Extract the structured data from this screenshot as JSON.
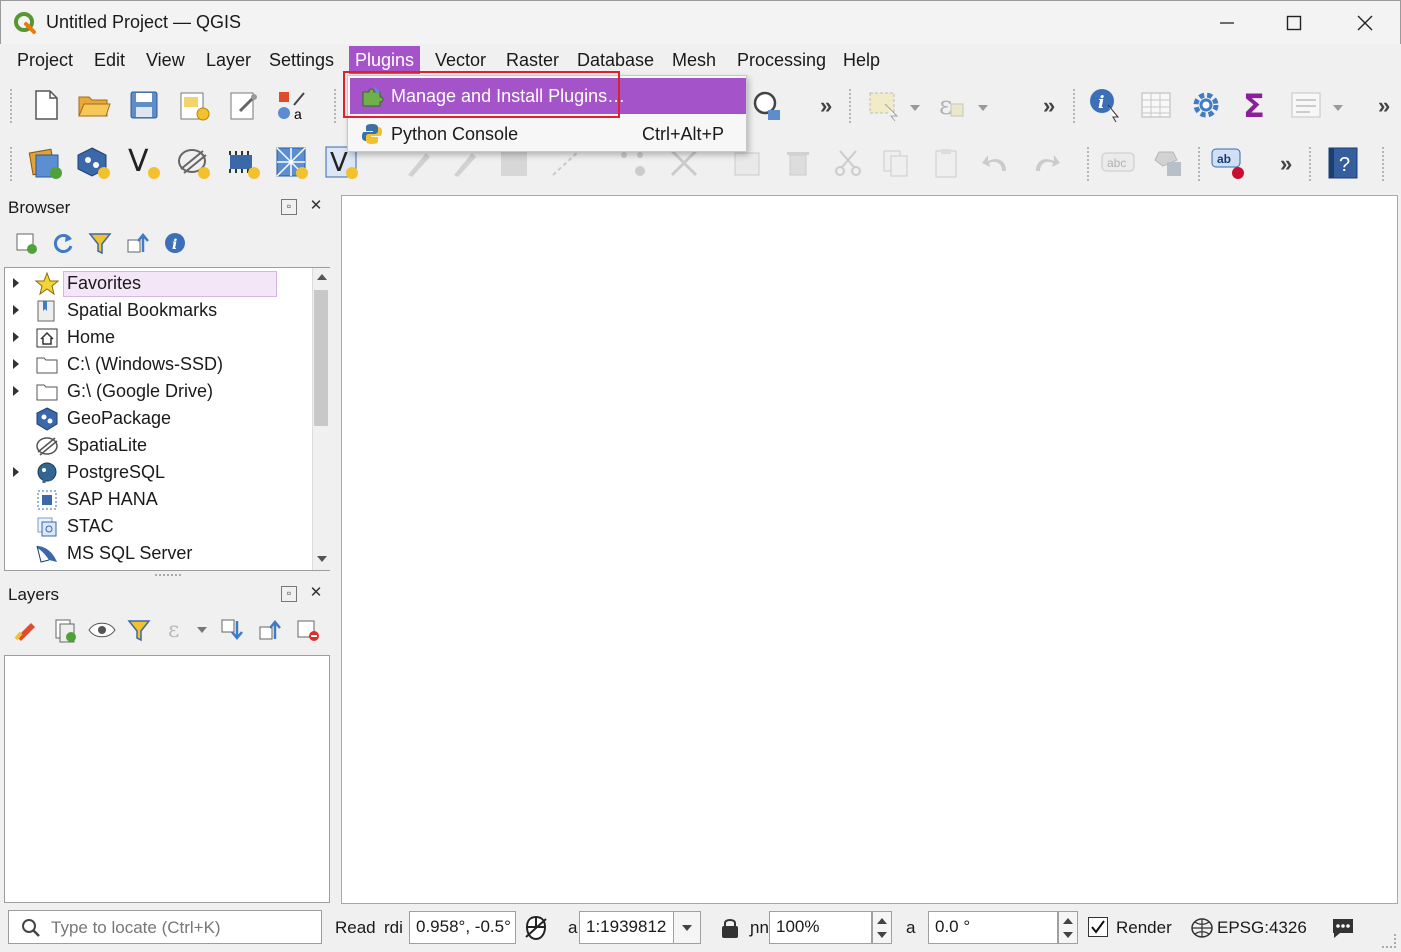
{
  "window": {
    "title": "Untitled Project — QGIS",
    "minimize_glyph": "—",
    "maximize_glyph": "☐",
    "close_glyph": "✕"
  },
  "menubar": {
    "items": [
      {
        "label": "Project"
      },
      {
        "label": "Edit"
      },
      {
        "label": "View"
      },
      {
        "label": "Layer"
      },
      {
        "label": "Settings"
      },
      {
        "label": "Plugins"
      },
      {
        "label": "Vector"
      },
      {
        "label": "Raster"
      },
      {
        "label": "Database"
      },
      {
        "label": "Mesh"
      },
      {
        "label": "Processing"
      },
      {
        "label": "Help"
      }
    ],
    "active": "Plugins"
  },
  "plugins_menu": {
    "items": [
      {
        "label": "Manage and Install Plugins…",
        "shortcut": ""
      },
      {
        "label": "Python Console",
        "shortcut": "Ctrl+Alt+P"
      }
    ]
  },
  "toolbar": {
    "overflow_glyph": "»"
  },
  "browser": {
    "title": "Browser",
    "items": [
      {
        "label": "Favorites",
        "icon": "star-icon",
        "expandable": true
      },
      {
        "label": "Spatial Bookmarks",
        "icon": "bookmark-icon",
        "expandable": true
      },
      {
        "label": "Home",
        "icon": "home-icon",
        "expandable": true
      },
      {
        "label": "C:\\ (Windows-SSD)",
        "icon": "folder-icon",
        "expandable": true
      },
      {
        "label": "G:\\ (Google Drive)",
        "icon": "folder-icon",
        "expandable": true
      },
      {
        "label": "GeoPackage",
        "icon": "geopackage-icon",
        "expandable": false
      },
      {
        "label": "SpatiaLite",
        "icon": "spatialite-icon",
        "expandable": false
      },
      {
        "label": "PostgreSQL",
        "icon": "postgresql-icon",
        "expandable": true
      },
      {
        "label": "SAP HANA",
        "icon": "saphana-icon",
        "expandable": false
      },
      {
        "label": "STAC",
        "icon": "stac-icon",
        "expandable": false
      },
      {
        "label": "MS SQL Server",
        "icon": "mssql-icon",
        "expandable": false
      }
    ]
  },
  "layers": {
    "title": "Layers"
  },
  "statusbar": {
    "locator_placeholder": "Type to locate (Ctrl+K)",
    "ready_text": "Read",
    "coordinate_label": "rdi",
    "coordinate_value": "0.958°, -0.5°",
    "scale_label": "a",
    "scale_value": "1:1939812",
    "magnifier_label": "ɲn",
    "magnifier_value": "100%",
    "rotation_label": "a",
    "rotation_value": "0.0 °",
    "render_label": "Render",
    "render_checked": true,
    "crs": "EPSG:4326"
  },
  "colors": {
    "accent": "#a553c9",
    "highlight_border": "#e0202a"
  }
}
